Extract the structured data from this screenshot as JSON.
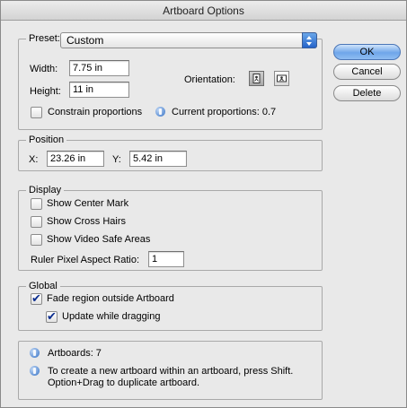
{
  "window": {
    "title": "Artboard Options"
  },
  "preset": {
    "label": "Preset:",
    "value": "Custom"
  },
  "size": {
    "width_label": "Width:",
    "width_value": "7.75 in",
    "height_label": "Height:",
    "height_value": "11 in",
    "orientation_label": "Orientation:",
    "constrain_label": "Constrain proportions",
    "current_proportions": "Current proportions: 0.7"
  },
  "position": {
    "legend": "Position",
    "x_label": "X:",
    "x_value": "23.26 in",
    "y_label": "Y:",
    "y_value": "5.42 in"
  },
  "display": {
    "legend": "Display",
    "center_mark": "Show Center Mark",
    "cross_hairs": "Show Cross Hairs",
    "video_safe": "Show Video Safe Areas",
    "ruler_label": "Ruler Pixel Aspect Ratio:",
    "ruler_value": "1"
  },
  "global": {
    "legend": "Global",
    "fade_label": "Fade region outside Artboard",
    "update_label": "Update while dragging"
  },
  "info": {
    "artboards": "Artboards: 7",
    "tip_line1": "To create a new artboard within an artboard, press Shift.",
    "tip_line2": "Option+Drag to duplicate artboard."
  },
  "buttons": {
    "ok": "OK",
    "cancel": "Cancel",
    "delete": "Delete"
  },
  "colors": {
    "default_button": "#6fa6ea",
    "check": "#0b2d8f",
    "window_bg": "#e9e9e9"
  }
}
